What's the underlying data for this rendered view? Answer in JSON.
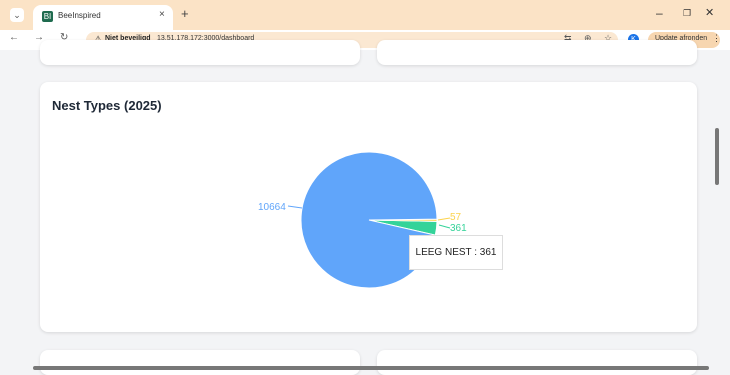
{
  "browser": {
    "tab_title": "BeeInspired",
    "favicon": "BI",
    "new_tab": "+",
    "tab_close": "×",
    "security_label": "Niet beveiligd",
    "url": "13.51.178.172:3000/dashboard",
    "profile_initial": "K",
    "update_label": "Update afronden"
  },
  "dashboard": {
    "card_title": "Nest Types (2025)"
  },
  "chart_data": {
    "type": "pie",
    "title": "Nest Types (2025)",
    "slices": [
      {
        "label": "",
        "value": 10664,
        "color": "#60a5fa"
      },
      {
        "label": "LEEG NEST",
        "value": 361,
        "color": "#34d399"
      },
      {
        "label": "",
        "value": 57,
        "color": "#fcd34d"
      }
    ],
    "tooltip": "LEEG NEST : 361"
  }
}
